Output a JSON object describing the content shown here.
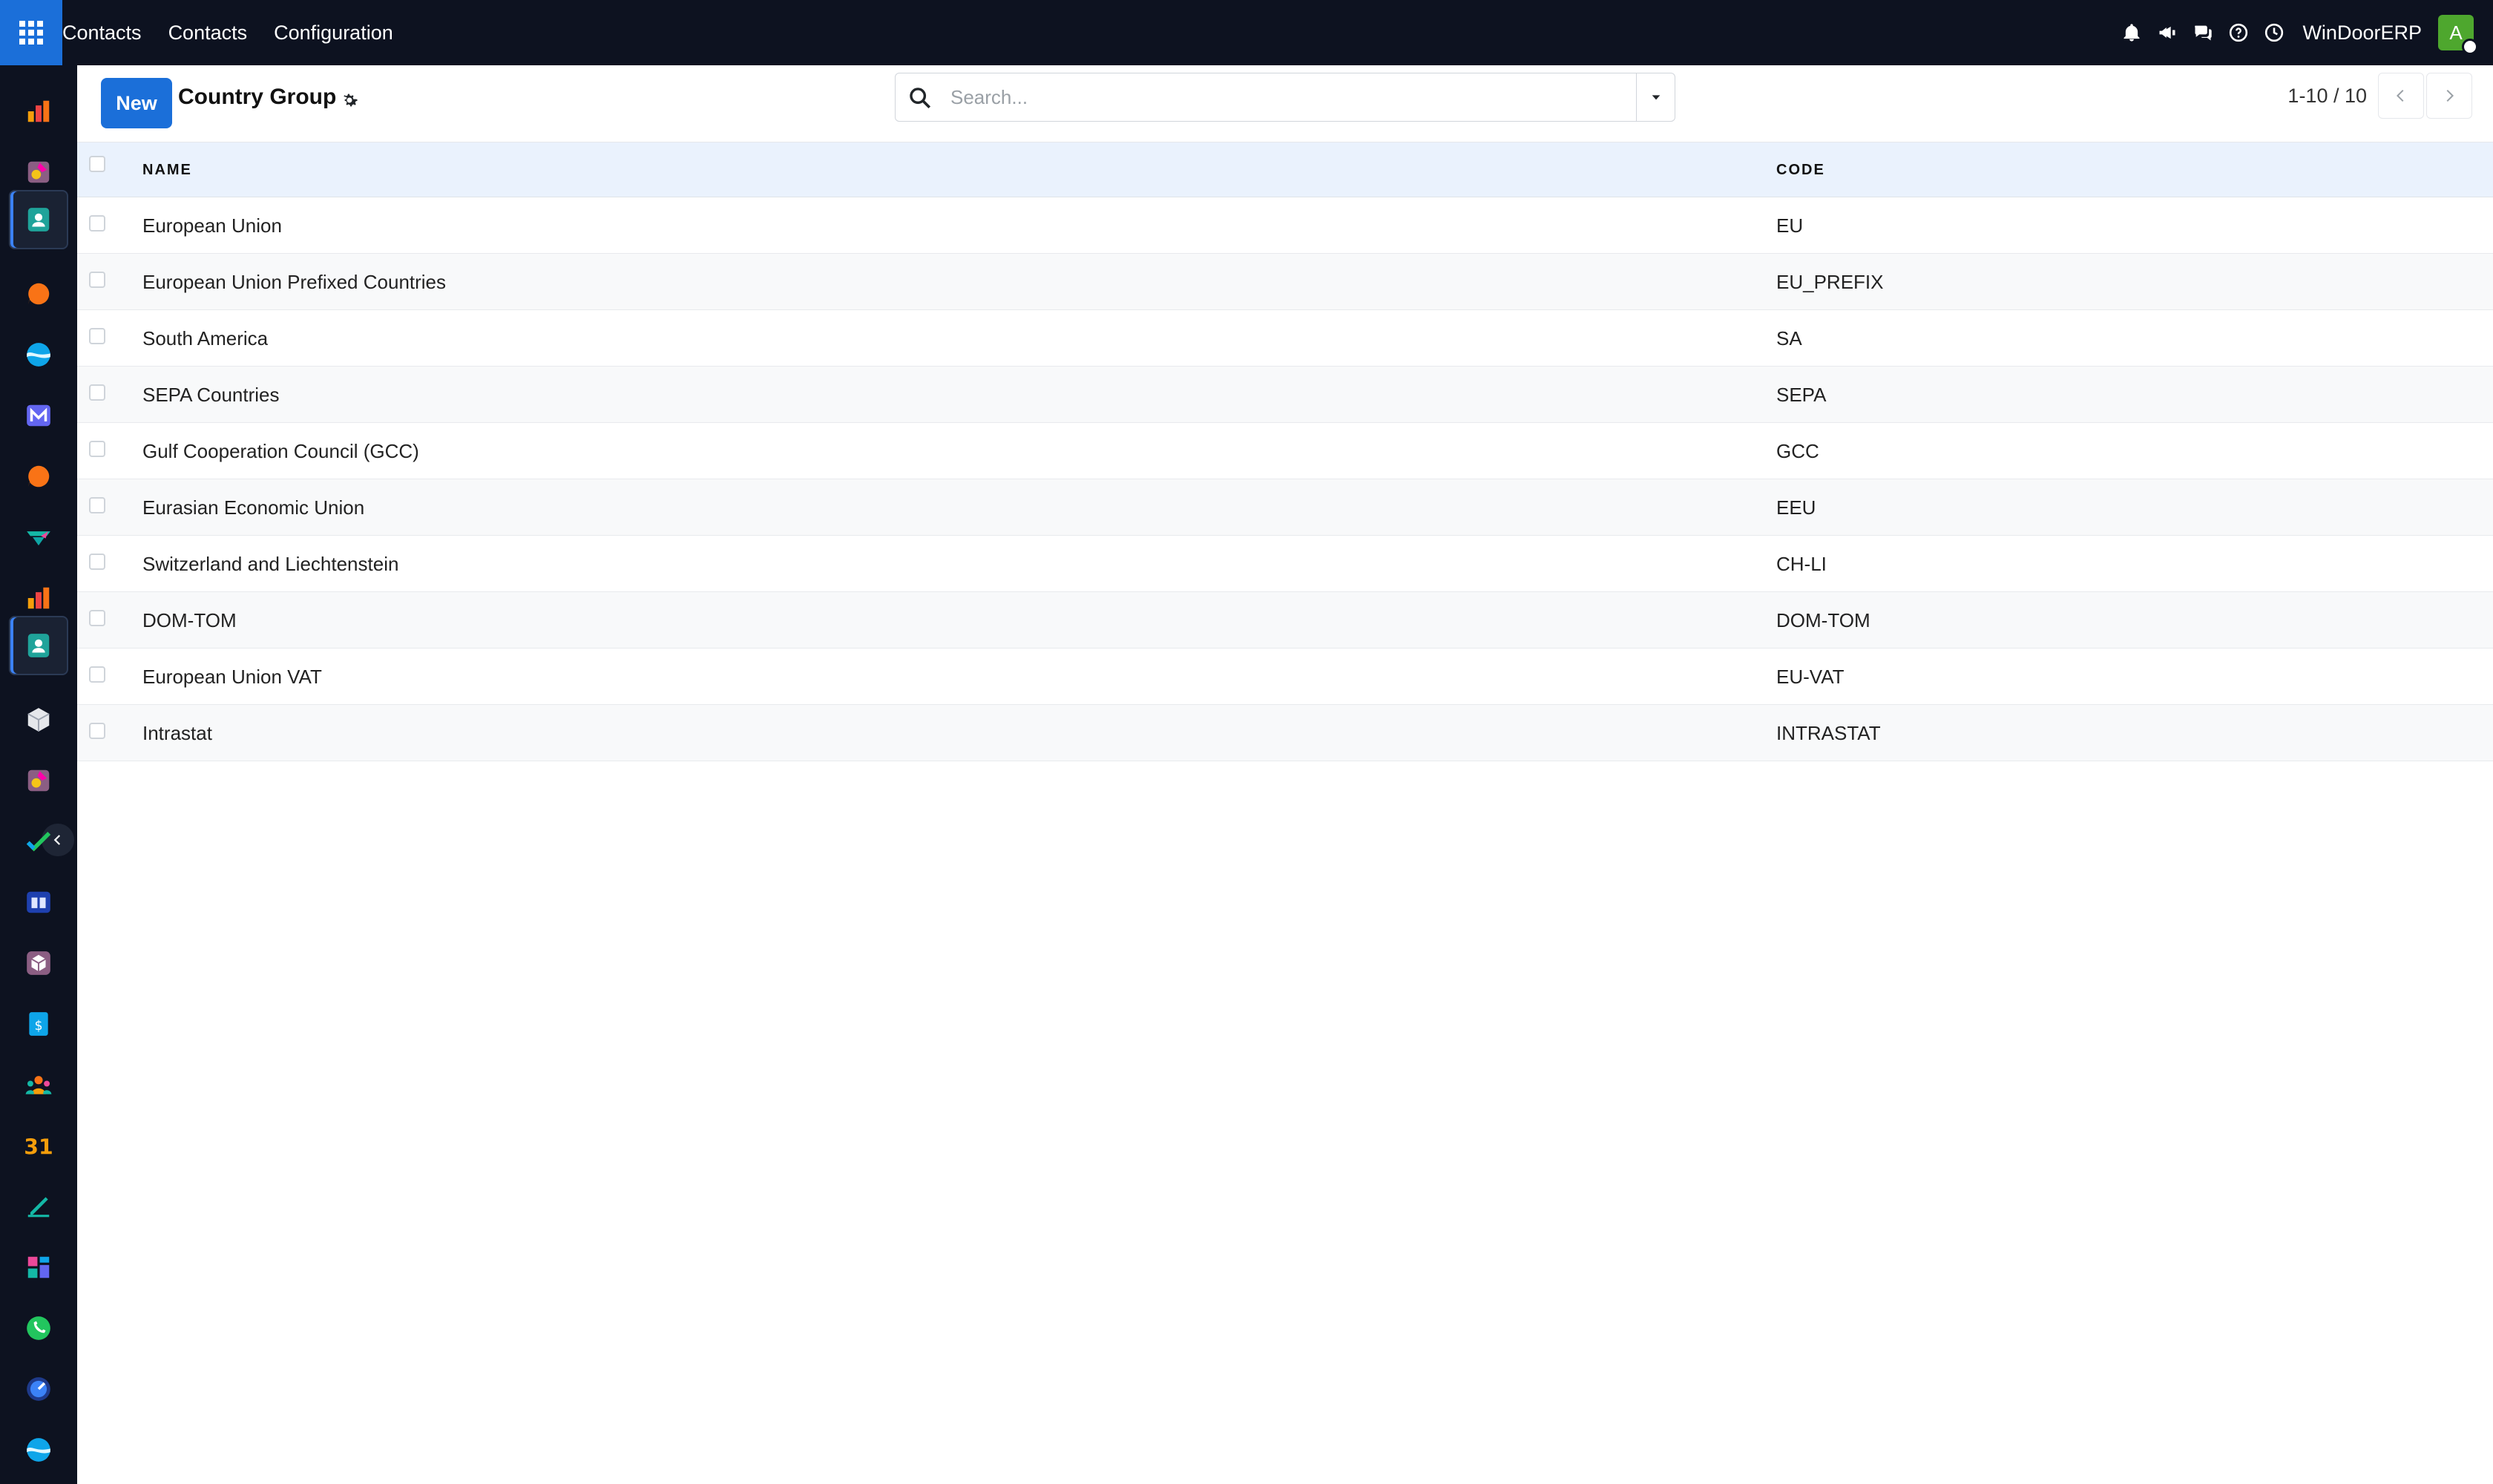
{
  "topbar": {
    "brand": "Contacts",
    "menu": [
      "Contacts",
      "Configuration"
    ],
    "company": "WinDoorERP",
    "avatar_initial": "A",
    "icons": [
      "bell-icon",
      "megaphone-icon",
      "chat-icon",
      "help-icon",
      "clock-icon"
    ]
  },
  "sidebar": {
    "apps": [
      "sales-app",
      "paint-app",
      "contacts-app",
      "discuss-app",
      "website-app",
      "mail-app",
      "livechat-app",
      "planning-app",
      "dashboard-app",
      "contacts-app-2",
      "inventory-app",
      "paint-app-2",
      "project-app",
      "knowledge-app",
      "package-app",
      "invoicing-app",
      "employees-app",
      "calendar-app",
      "sign-app",
      "dashboards-app",
      "whatsapp-app",
      "time-off-app",
      "website-app-2"
    ]
  },
  "control": {
    "new_label": "New",
    "title": "Country Group",
    "search_placeholder": "Search...",
    "pager": "1-10 / 10"
  },
  "table": {
    "headers": {
      "name": "NAME",
      "code": "CODE"
    },
    "rows": [
      {
        "name": "European Union",
        "code": "EU"
      },
      {
        "name": "European Union Prefixed Countries",
        "code": "EU_PREFIX"
      },
      {
        "name": "South America",
        "code": "SA"
      },
      {
        "name": "SEPA Countries",
        "code": "SEPA"
      },
      {
        "name": "Gulf Cooperation Council (GCC)",
        "code": "GCC"
      },
      {
        "name": "Eurasian Economic Union",
        "code": "EEU"
      },
      {
        "name": "Switzerland and Liechtenstein",
        "code": "CH-LI"
      },
      {
        "name": "DOM-TOM",
        "code": "DOM-TOM"
      },
      {
        "name": "European Union VAT",
        "code": "EU-VAT"
      },
      {
        "name": "Intrastat",
        "code": "INTRASTAT"
      }
    ]
  },
  "colors": {
    "topbar": "#0d1220",
    "accent": "#1b6fd9",
    "header_row": "#eaf2fd",
    "avatar": "#4ea72e"
  }
}
